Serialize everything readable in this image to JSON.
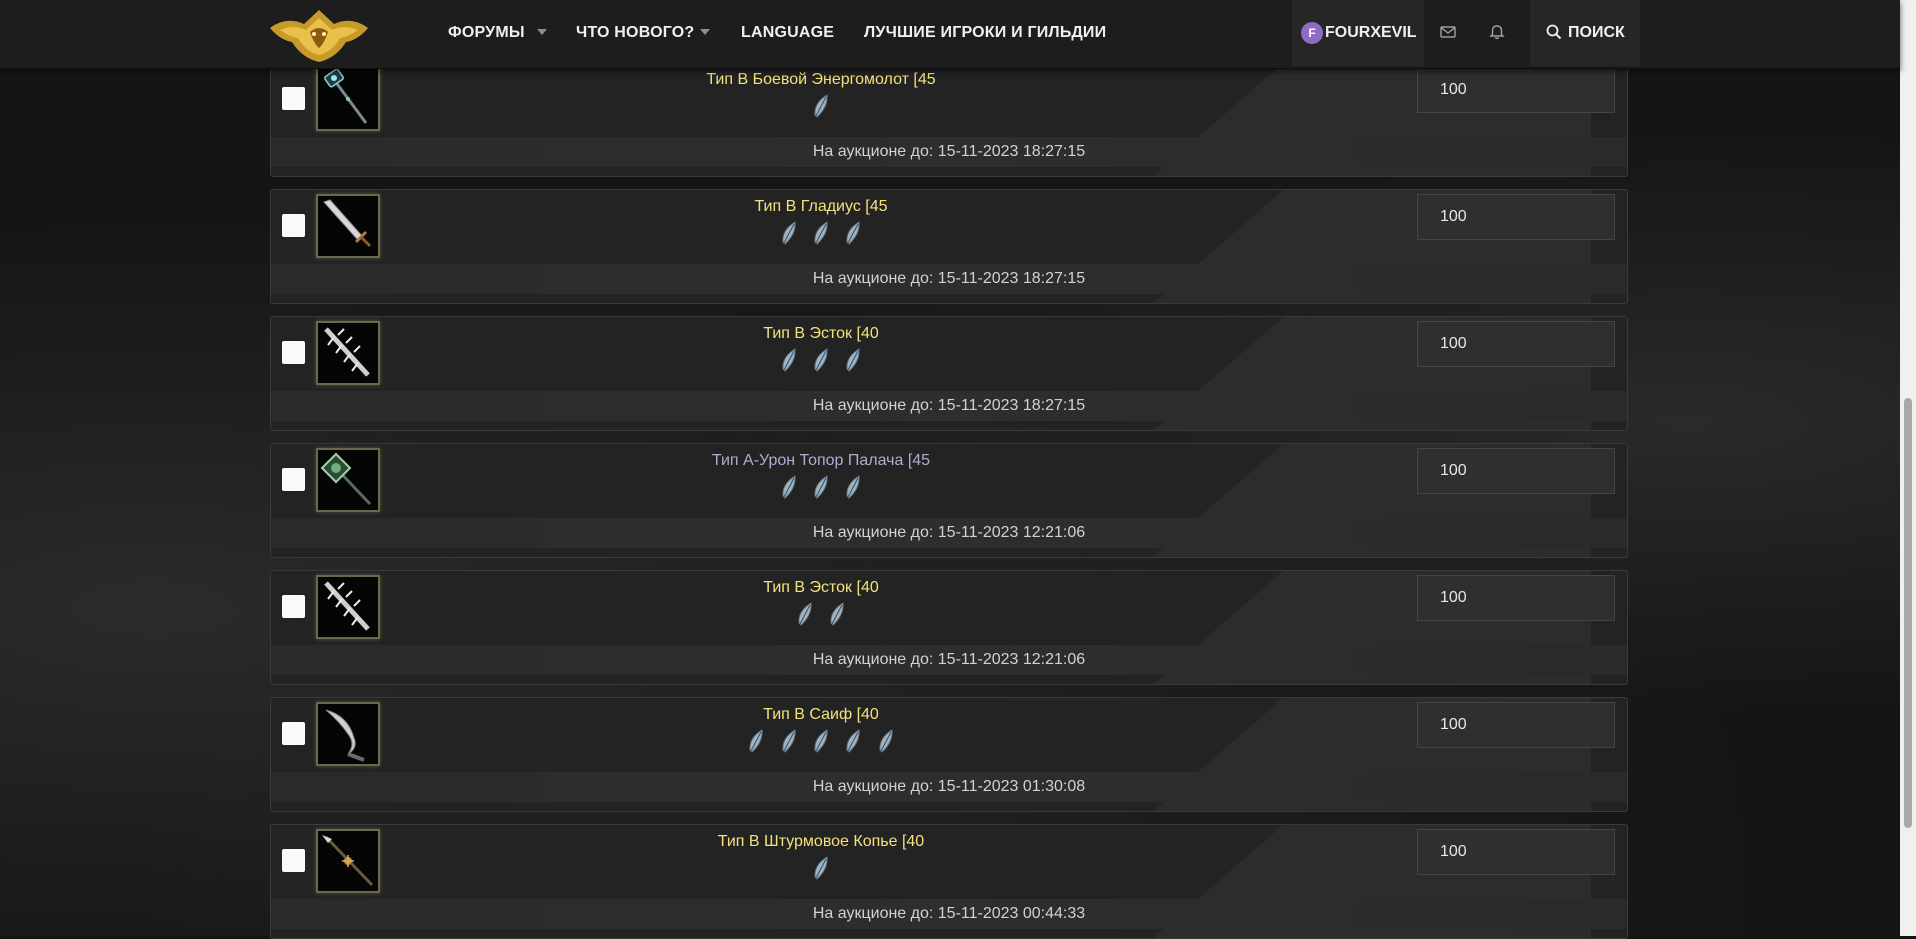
{
  "nav": {
    "forums": "ФОРУМЫ",
    "whats_new": "ЧТО НОВОГО?",
    "language": "LANGUAGE",
    "top_players": "ЛУЧШИЕ ИГРОКИ И ГИЛЬДИИ",
    "avatar_letter": "F",
    "username": "FOURXEVIL",
    "search": "ПОИСК"
  },
  "listings": [
    {
      "name": "Тип В Боевой Энергомолот [45",
      "gems": 1,
      "price": "100",
      "expiry": "На аукционе до: 15-11-2023 18:27:15",
      "icon": "energy-hammer-icon"
    },
    {
      "name": "Тип В Гладиус [45",
      "gems": 3,
      "price": "100",
      "expiry": "На аукционе до: 15-11-2023 18:27:15",
      "icon": "gladius-icon"
    },
    {
      "name": "Тип В Эсток [40",
      "gems": 3,
      "price": "100",
      "expiry": "На аукционе до: 15-11-2023 18:27:15",
      "icon": "estoc-icon"
    },
    {
      "name": "Тип А-Урон Топор Палача [45",
      "gems": 3,
      "price": "100",
      "expiry": "На аукционе до: 15-11-2023 12:21:06",
      "icon": "executioner-axe-icon"
    },
    {
      "name": "Тип В Эсток [40",
      "gems": 2,
      "price": "100",
      "expiry": "На аукционе до: 15-11-2023 12:21:06",
      "icon": "estoc-icon"
    },
    {
      "name": "Тип В Саиф [40",
      "gems": 5,
      "price": "100",
      "expiry": "На аукционе до: 15-11-2023 01:30:08",
      "icon": "saif-icon"
    },
    {
      "name": "Тип В Штурмовое Копье [40",
      "gems": 1,
      "price": "100",
      "expiry": "На аукционе до: 15-11-2023 00:44:33",
      "icon": "assault-spear-icon"
    }
  ],
  "colors": {
    "item_name_gold": "#f3e27a",
    "item_name_purple": "#b6a9d2",
    "avatar_purple": "#8e6bc7"
  }
}
